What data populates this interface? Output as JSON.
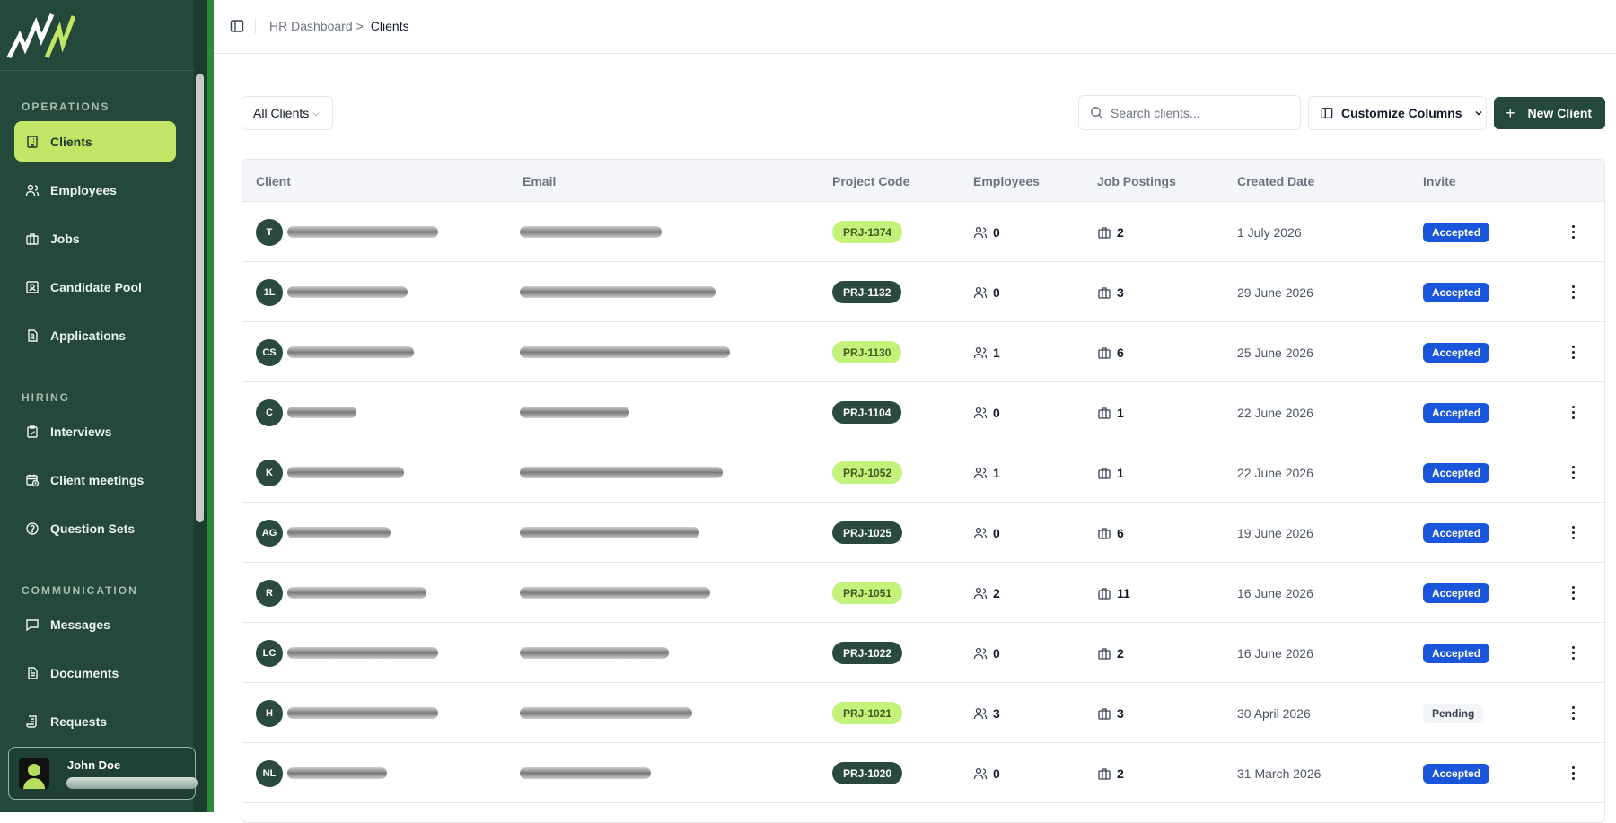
{
  "sidebar": {
    "sections": [
      {
        "title": "OPERATIONS"
      },
      {
        "title": "HIRING"
      },
      {
        "title": "COMMUNICATION"
      }
    ],
    "items": [
      {
        "label": "Clients",
        "icon": "building-icon"
      },
      {
        "label": "Employees",
        "icon": "users-icon"
      },
      {
        "label": "Jobs",
        "icon": "briefcase-icon"
      },
      {
        "label": "Candidate Pool",
        "icon": "id-card-icon"
      },
      {
        "label": "Applications",
        "icon": "file-user-icon"
      },
      {
        "label": "Interviews",
        "icon": "clipboard-check-icon"
      },
      {
        "label": "Client meetings",
        "icon": "calendar-clock-icon"
      },
      {
        "label": "Question Sets",
        "icon": "help-circle-icon"
      },
      {
        "label": "Messages",
        "icon": "message-square-icon"
      },
      {
        "label": "Documents",
        "icon": "file-text-icon"
      },
      {
        "label": "Requests",
        "icon": "scroll-icon"
      }
    ],
    "user": {
      "name": "John Doe"
    }
  },
  "header": {
    "breadcrumb_parent": "HR Dashboard",
    "breadcrumb_sep": ">",
    "breadcrumb_current": "Clients"
  },
  "toolbar": {
    "filter_label": "All Clients",
    "search_placeholder": "Search clients...",
    "customize_label": "Customize Columns",
    "new_label": "New Client"
  },
  "table": {
    "columns": [
      "Client",
      "Email",
      "Project Code",
      "Employees",
      "Job Postings",
      "Created Date",
      "Invite"
    ],
    "rows": [
      {
        "initials": "T",
        "code": "PRJ-1374",
        "code_style": "light",
        "employees": "0",
        "jobs": "2",
        "created": "1 July 2026",
        "invite": "Accepted"
      },
      {
        "initials": "1L",
        "code": "PRJ-1132",
        "code_style": "dark",
        "employees": "0",
        "jobs": "3",
        "created": "29 June 2026",
        "invite": "Accepted"
      },
      {
        "initials": "CS",
        "code": "PRJ-1130",
        "code_style": "light",
        "employees": "1",
        "jobs": "6",
        "created": "25 June 2026",
        "invite": "Accepted"
      },
      {
        "initials": "C",
        "code": "PRJ-1104",
        "code_style": "dark",
        "employees": "0",
        "jobs": "1",
        "created": "22 June 2026",
        "invite": "Accepted"
      },
      {
        "initials": "K",
        "code": "PRJ-1052",
        "code_style": "light",
        "employees": "1",
        "jobs": "1",
        "created": "22 June 2026",
        "invite": "Accepted"
      },
      {
        "initials": "AG",
        "code": "PRJ-1025",
        "code_style": "dark",
        "employees": "0",
        "jobs": "6",
        "created": "19 June 2026",
        "invite": "Accepted"
      },
      {
        "initials": "R",
        "code": "PRJ-1051",
        "code_style": "light",
        "employees": "2",
        "jobs": "11",
        "created": "16 June 2026",
        "invite": "Accepted"
      },
      {
        "initials": "LC",
        "code": "PRJ-1022",
        "code_style": "dark",
        "employees": "0",
        "jobs": "2",
        "created": "16 June 2026",
        "invite": "Accepted"
      },
      {
        "initials": "H",
        "code": "PRJ-1021",
        "code_style": "light",
        "employees": "3",
        "jobs": "3",
        "created": "30 April 2026",
        "invite": "Pending"
      },
      {
        "initials": "NL",
        "code": "PRJ-1020",
        "code_style": "dark",
        "employees": "0",
        "jobs": "2",
        "created": "31 March 2026",
        "invite": "Accepted"
      }
    ]
  },
  "colors": {
    "sidebar_bg": "#24483a",
    "active_nav": "#c3e566",
    "accepted": "#1a56db",
    "primary_button": "#24483a"
  }
}
